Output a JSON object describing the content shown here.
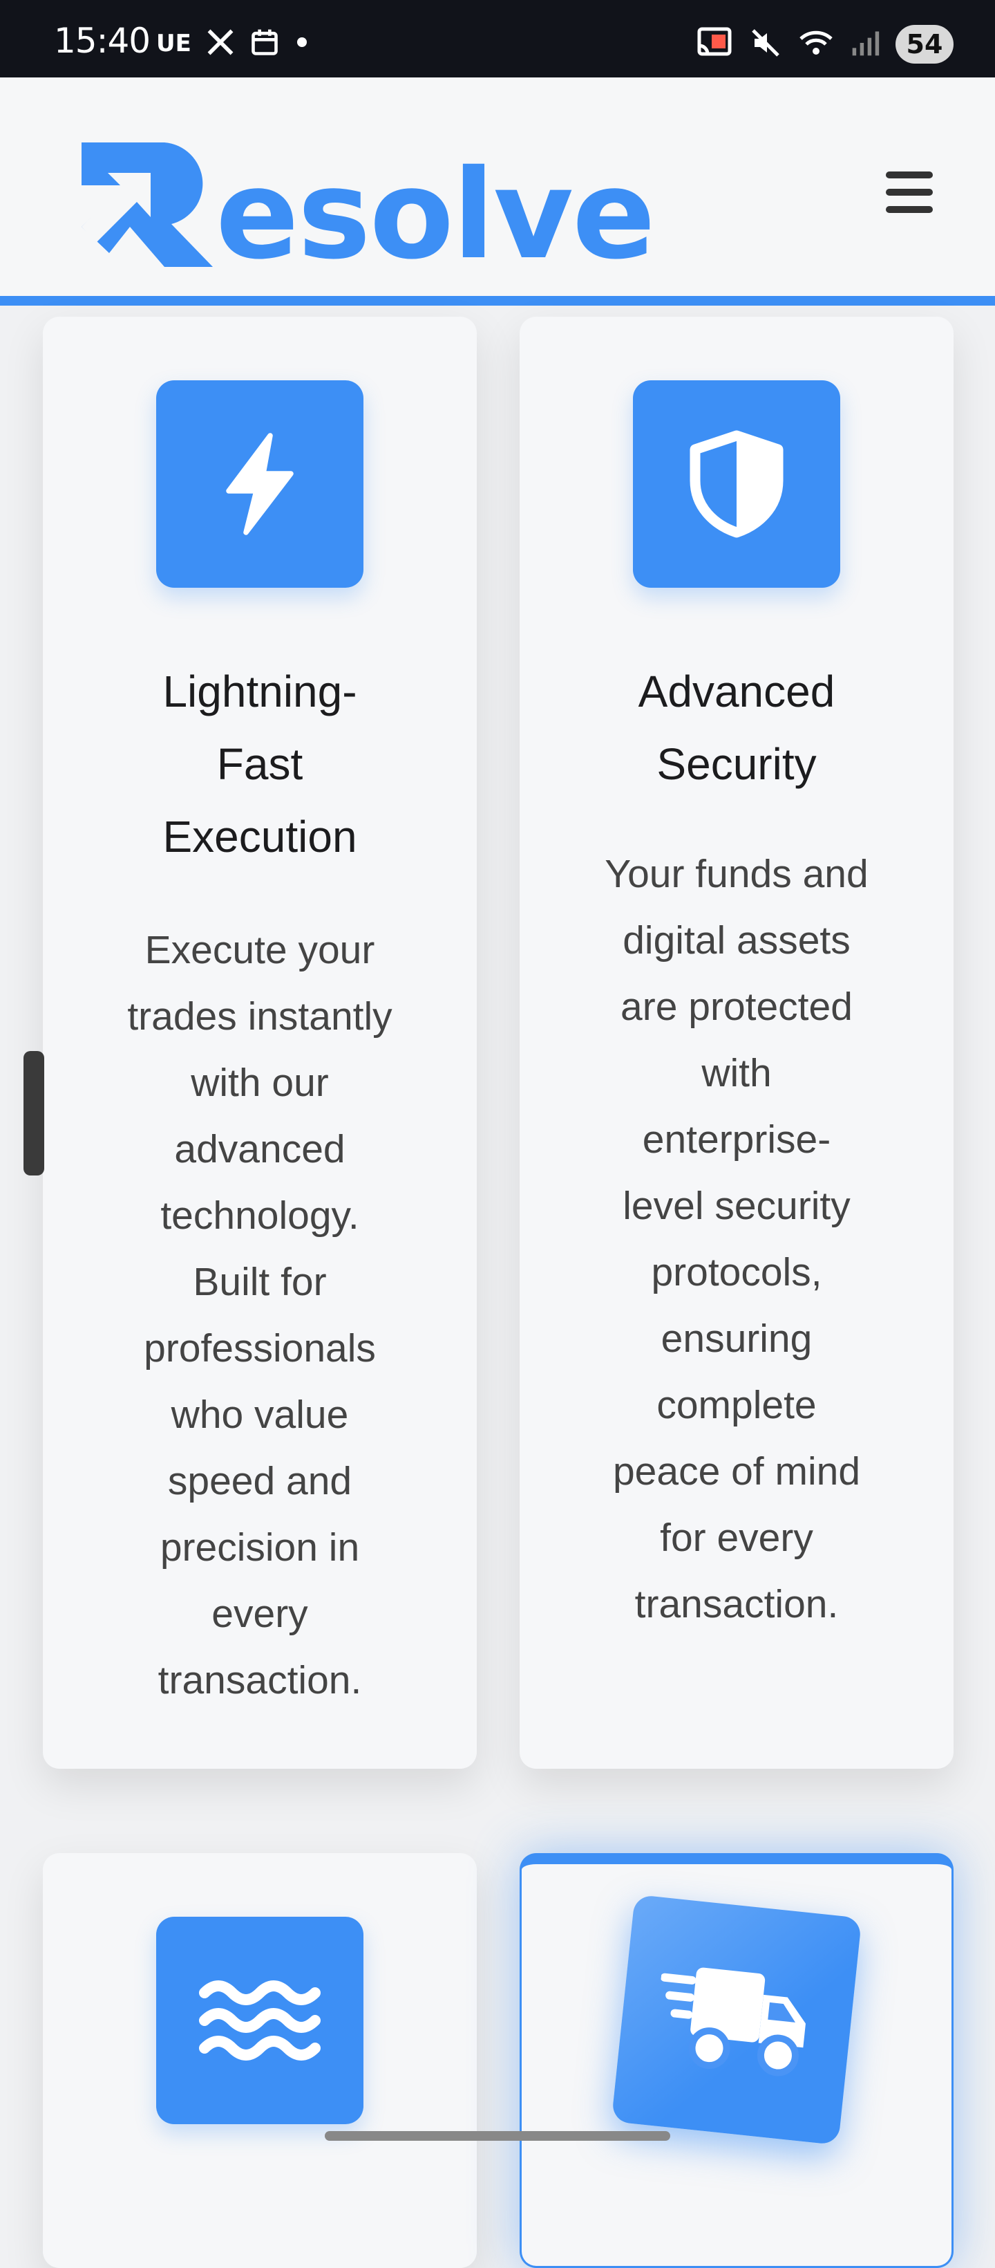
{
  "status_bar": {
    "time": "15:40",
    "carrier_label": "UE",
    "battery": "54",
    "left_icons": [
      "x-logo-icon",
      "calendar-icon",
      "dot-icon"
    ],
    "right_icons": [
      "cast-icon",
      "mute-icon",
      "wifi-icon",
      "signal-icon"
    ]
  },
  "header": {
    "logo_text": "esolve",
    "logo_initial_icon": "resolve-arrow-r-logo",
    "menu_icon": "hamburger-menu-icon"
  },
  "accent_color": "#3d8ff5",
  "features": [
    {
      "icon": "lightning-bolt-icon",
      "title_lines": [
        "Lightning-",
        "Fast",
        "Execution"
      ],
      "description_lines": [
        "Execute your",
        "trades instantly",
        "with our",
        "advanced",
        "technology.",
        "Built for",
        "professionals",
        "who value",
        "speed and",
        "precision in",
        "every",
        "transaction."
      ]
    },
    {
      "icon": "shield-icon",
      "title_lines": [
        "Advanced",
        "Security"
      ],
      "description_lines": [
        "Your funds and",
        "digital assets",
        "are protected",
        "with",
        "enterprise-",
        "level security",
        "protocols,",
        "ensuring",
        "complete",
        "peace of mind",
        "for every",
        "transaction."
      ]
    },
    {
      "icon": "water-waves-icon"
    },
    {
      "icon": "delivery-truck-icon",
      "highlighted": true
    }
  ]
}
